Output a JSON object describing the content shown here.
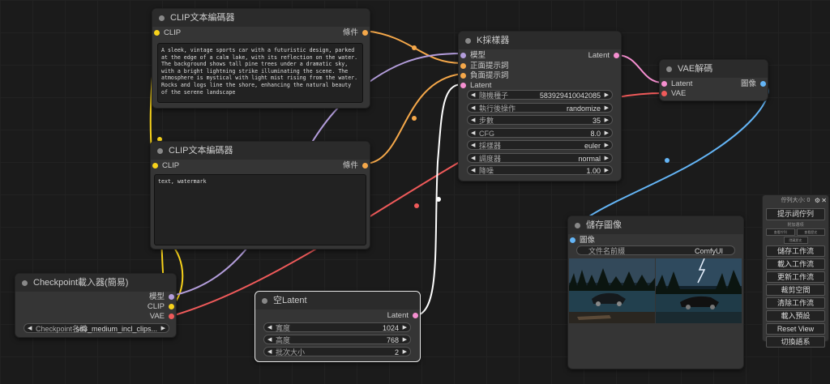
{
  "colors": {
    "clip": "#f7d21b",
    "conditioning": "#f5a84a",
    "model": "#b39ddb",
    "latent": "#f58fd0",
    "vae": "#ef5a5a",
    "image": "#64b5f6",
    "pixels_wire": "#ffffff"
  },
  "clip_pos": {
    "title": "CLIP文本編碼器",
    "in_label": "CLIP",
    "out_label": "條件",
    "text": "A sleek, vintage sports car with a futuristic design, parked at the edge of a calm lake, with its reflection on the water. The background shows tall pine trees under a dramatic sky, with a bright lightning strike illuminating the scene. The atmosphere is mystical with light mist rising from the water. Rocks and logs line the shore, enhancing the natural beauty of the serene landscape"
  },
  "clip_neg": {
    "title": "CLIP文本編碼器",
    "in_label": "CLIP",
    "out_label": "條件",
    "text": "text, watermark"
  },
  "ksampler": {
    "title": "K採樣器",
    "inputs": [
      "模型",
      "正面提示詞",
      "負面提示詞",
      "Latent"
    ],
    "output": "Latent",
    "widgets": [
      {
        "label": "隨機種子",
        "value": "583929410042085"
      },
      {
        "label": "執行後操作",
        "value": "randomize"
      },
      {
        "label": "步數",
        "value": "35"
      },
      {
        "label": "CFG",
        "value": "8.0"
      },
      {
        "label": "採樣器",
        "value": "euler"
      },
      {
        "label": "調度器",
        "value": "normal"
      },
      {
        "label": "降噪",
        "value": "1.00"
      }
    ]
  },
  "vae_decode": {
    "title": "VAE解碼",
    "inputs": [
      "Latent",
      "VAE"
    ],
    "output": "圖像"
  },
  "save_image": {
    "title": "儲存圖像",
    "input": "圖像",
    "widget_label": "文件名前綴",
    "widget_value": "ComfyUI"
  },
  "checkpoint": {
    "title": "Checkpoint載入器(簡易)",
    "outputs": [
      "模型",
      "CLIP",
      "VAE"
    ],
    "widget_label": "Checkpoint名稱",
    "widget_value": "sd3_medium_incl_clips..."
  },
  "empty_latent": {
    "title": "空Latent",
    "output": "Latent",
    "widgets": [
      {
        "label": "寬度",
        "value": "1024"
      },
      {
        "label": "高度",
        "value": "768"
      },
      {
        "label": "批次大小",
        "value": "2"
      }
    ]
  },
  "queue_panel": {
    "header": "佇列大小: 0",
    "primary_button": "提示詞佇列",
    "extra_options": "附加選項",
    "mini_labels": [
      "查看佇列",
      "查看歷史",
      "隱藏歷史"
    ],
    "buttons": [
      "儲存工作流",
      "載入工作流",
      "更新工作流",
      "裁剪空間",
      "清除工作流",
      "載入預設",
      "Reset View",
      "切換語系"
    ]
  }
}
